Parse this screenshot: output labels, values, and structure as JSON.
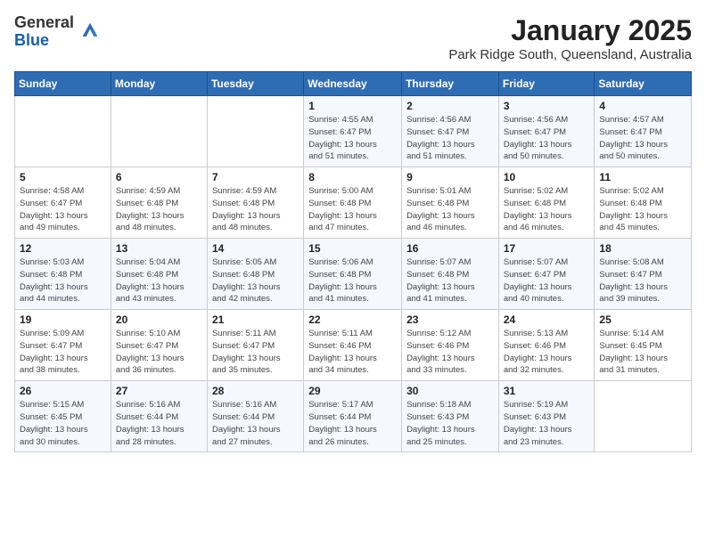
{
  "header": {
    "logo_general": "General",
    "logo_blue": "Blue",
    "month": "January 2025",
    "location": "Park Ridge South, Queensland, Australia"
  },
  "weekdays": [
    "Sunday",
    "Monday",
    "Tuesday",
    "Wednesday",
    "Thursday",
    "Friday",
    "Saturday"
  ],
  "weeks": [
    [
      {
        "day": "",
        "info": ""
      },
      {
        "day": "",
        "info": ""
      },
      {
        "day": "",
        "info": ""
      },
      {
        "day": "1",
        "info": "Sunrise: 4:55 AM\nSunset: 6:47 PM\nDaylight: 13 hours\nand 51 minutes."
      },
      {
        "day": "2",
        "info": "Sunrise: 4:56 AM\nSunset: 6:47 PM\nDaylight: 13 hours\nand 51 minutes."
      },
      {
        "day": "3",
        "info": "Sunrise: 4:56 AM\nSunset: 6:47 PM\nDaylight: 13 hours\nand 50 minutes."
      },
      {
        "day": "4",
        "info": "Sunrise: 4:57 AM\nSunset: 6:47 PM\nDaylight: 13 hours\nand 50 minutes."
      }
    ],
    [
      {
        "day": "5",
        "info": "Sunrise: 4:58 AM\nSunset: 6:47 PM\nDaylight: 13 hours\nand 49 minutes."
      },
      {
        "day": "6",
        "info": "Sunrise: 4:59 AM\nSunset: 6:48 PM\nDaylight: 13 hours\nand 48 minutes."
      },
      {
        "day": "7",
        "info": "Sunrise: 4:59 AM\nSunset: 6:48 PM\nDaylight: 13 hours\nand 48 minutes."
      },
      {
        "day": "8",
        "info": "Sunrise: 5:00 AM\nSunset: 6:48 PM\nDaylight: 13 hours\nand 47 minutes."
      },
      {
        "day": "9",
        "info": "Sunrise: 5:01 AM\nSunset: 6:48 PM\nDaylight: 13 hours\nand 46 minutes."
      },
      {
        "day": "10",
        "info": "Sunrise: 5:02 AM\nSunset: 6:48 PM\nDaylight: 13 hours\nand 46 minutes."
      },
      {
        "day": "11",
        "info": "Sunrise: 5:02 AM\nSunset: 6:48 PM\nDaylight: 13 hours\nand 45 minutes."
      }
    ],
    [
      {
        "day": "12",
        "info": "Sunrise: 5:03 AM\nSunset: 6:48 PM\nDaylight: 13 hours\nand 44 minutes."
      },
      {
        "day": "13",
        "info": "Sunrise: 5:04 AM\nSunset: 6:48 PM\nDaylight: 13 hours\nand 43 minutes."
      },
      {
        "day": "14",
        "info": "Sunrise: 5:05 AM\nSunset: 6:48 PM\nDaylight: 13 hours\nand 42 minutes."
      },
      {
        "day": "15",
        "info": "Sunrise: 5:06 AM\nSunset: 6:48 PM\nDaylight: 13 hours\nand 41 minutes."
      },
      {
        "day": "16",
        "info": "Sunrise: 5:07 AM\nSunset: 6:48 PM\nDaylight: 13 hours\nand 41 minutes."
      },
      {
        "day": "17",
        "info": "Sunrise: 5:07 AM\nSunset: 6:47 PM\nDaylight: 13 hours\nand 40 minutes."
      },
      {
        "day": "18",
        "info": "Sunrise: 5:08 AM\nSunset: 6:47 PM\nDaylight: 13 hours\nand 39 minutes."
      }
    ],
    [
      {
        "day": "19",
        "info": "Sunrise: 5:09 AM\nSunset: 6:47 PM\nDaylight: 13 hours\nand 38 minutes."
      },
      {
        "day": "20",
        "info": "Sunrise: 5:10 AM\nSunset: 6:47 PM\nDaylight: 13 hours\nand 36 minutes."
      },
      {
        "day": "21",
        "info": "Sunrise: 5:11 AM\nSunset: 6:47 PM\nDaylight: 13 hours\nand 35 minutes."
      },
      {
        "day": "22",
        "info": "Sunrise: 5:11 AM\nSunset: 6:46 PM\nDaylight: 13 hours\nand 34 minutes."
      },
      {
        "day": "23",
        "info": "Sunrise: 5:12 AM\nSunset: 6:46 PM\nDaylight: 13 hours\nand 33 minutes."
      },
      {
        "day": "24",
        "info": "Sunrise: 5:13 AM\nSunset: 6:46 PM\nDaylight: 13 hours\nand 32 minutes."
      },
      {
        "day": "25",
        "info": "Sunrise: 5:14 AM\nSunset: 6:45 PM\nDaylight: 13 hours\nand 31 minutes."
      }
    ],
    [
      {
        "day": "26",
        "info": "Sunrise: 5:15 AM\nSunset: 6:45 PM\nDaylight: 13 hours\nand 30 minutes."
      },
      {
        "day": "27",
        "info": "Sunrise: 5:16 AM\nSunset: 6:44 PM\nDaylight: 13 hours\nand 28 minutes."
      },
      {
        "day": "28",
        "info": "Sunrise: 5:16 AM\nSunset: 6:44 PM\nDaylight: 13 hours\nand 27 minutes."
      },
      {
        "day": "29",
        "info": "Sunrise: 5:17 AM\nSunset: 6:44 PM\nDaylight: 13 hours\nand 26 minutes."
      },
      {
        "day": "30",
        "info": "Sunrise: 5:18 AM\nSunset: 6:43 PM\nDaylight: 13 hours\nand 25 minutes."
      },
      {
        "day": "31",
        "info": "Sunrise: 5:19 AM\nSunset: 6:43 PM\nDaylight: 13 hours\nand 23 minutes."
      },
      {
        "day": "",
        "info": ""
      }
    ]
  ]
}
